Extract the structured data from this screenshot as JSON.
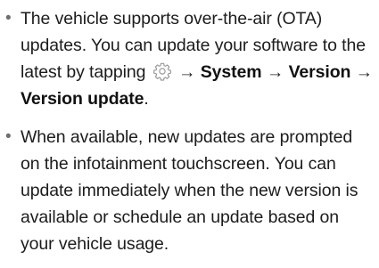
{
  "bullets": {
    "marker": "•",
    "item1": {
      "text_a": "The vehicle supports over-the-air (OTA) updates. You can update your software to the latest by tapping",
      "gear_icon": "gear-icon",
      "arrow1": "→",
      "bold_system": "System",
      "arrow2": "→",
      "bold_version": "Version",
      "arrow3": "→",
      "bold_version_update": "Version update",
      "period": "."
    },
    "item2": {
      "text": "When available, new updates are prompted on the infotainment touchscreen. You can update immediately when the new version is available or schedule an update based on your vehicle usage."
    }
  },
  "colors": {
    "text": "#1c1c1c",
    "bullet": "#6e6e6e",
    "icon_stroke": "#9a9a9a"
  }
}
